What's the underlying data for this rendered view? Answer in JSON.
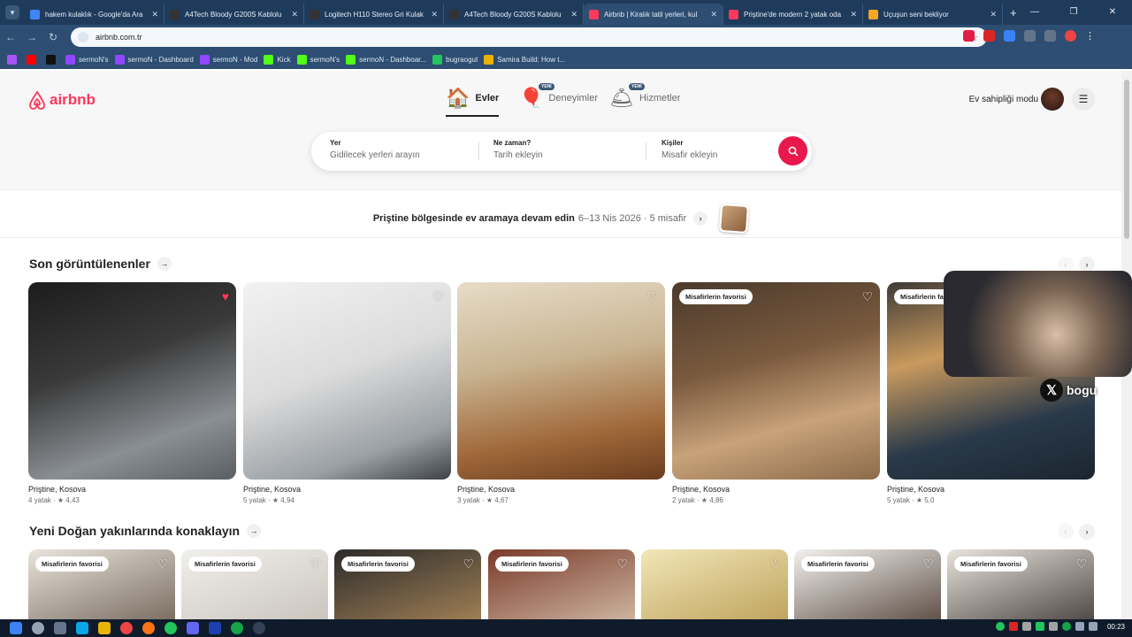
{
  "browser": {
    "tabs": [
      {
        "title": "hakem kulaklık - Google'da Ara",
        "color": "#4285f4",
        "active": false
      },
      {
        "title": "A4Tech Bloody G200S Kablolu",
        "color": "#333333",
        "active": false
      },
      {
        "title": "Logitech H110 Stereo Gri Kulak",
        "color": "#333333",
        "active": false
      },
      {
        "title": "A4Tech Bloody G200S Kablolu",
        "color": "#333333",
        "active": false
      },
      {
        "title": "Airbnb | Kiralık tatil yerleri, kul",
        "color": "#ff385c",
        "active": true
      },
      {
        "title": "Priştine'de modern 2 yatak oda",
        "color": "#ff385c",
        "active": false
      },
      {
        "title": "Uçuşun seni bekliyor",
        "color": "#f5a623",
        "active": false
      }
    ],
    "url": "airbnb.com.tr",
    "bookmarks": [
      {
        "label": "",
        "color": "#a855f7"
      },
      {
        "label": "",
        "color": "#ff0000"
      },
      {
        "label": "",
        "color": "#111111"
      },
      {
        "label": "sermoN's",
        "color": "#9146ff"
      },
      {
        "label": "sermoN - Dashboard",
        "color": "#9146ff"
      },
      {
        "label": "sermoN - Mod",
        "color": "#9146ff"
      },
      {
        "label": "Kick",
        "color": "#53fc18"
      },
      {
        "label": "sermoN's",
        "color": "#53fc18"
      },
      {
        "label": "sermoN - Dashboar...",
        "color": "#53fc18"
      },
      {
        "label": "bugraogut",
        "color": "#22c55e"
      },
      {
        "label": "Samira Build: How t...",
        "color": "#eab308"
      }
    ]
  },
  "header": {
    "logo": "airbnb",
    "categories": [
      {
        "label": "Evler",
        "icon": "house-icon",
        "glyph": "🏠",
        "new": ""
      },
      {
        "label": "Deneyimler",
        "icon": "balloon-icon",
        "glyph": "🎈",
        "new": "YENİ"
      },
      {
        "label": "Hizmetler",
        "icon": "bell-icon",
        "glyph": "🛎",
        "new": "YENİ"
      }
    ],
    "host_mode": "Ev sahipliği modu"
  },
  "search": {
    "where_label": "Yer",
    "where_placeholder": "Gidilecek yerleri arayın",
    "when_label": "Ne zaman?",
    "when_placeholder": "Tarih ekleyin",
    "who_label": "Kişiler",
    "who_placeholder": "Misafir ekleyin"
  },
  "continue_search": {
    "text": "Priştine bölgesinde ev aramaya devam edin",
    "details": "6–13 Nis 2026 · 5 misafir"
  },
  "recent": {
    "title": "Son görüntülenenler",
    "cards": [
      {
        "location": "Priştine, Kosova",
        "meta": "4 yatak · ★ 4,43",
        "badge": "",
        "liked": true,
        "img": "linear-gradient(160deg,#1c1c1c 0%,#3a3a3a 40%,#8a8f94 75%,#5a5f63 100%)"
      },
      {
        "location": "Priştine, Kosova",
        "meta": "5 yatak · ★ 4,94",
        "badge": "",
        "liked": false,
        "img": "linear-gradient(160deg,#f2f2f2 0%,#dcdcdc 45%,#9aa0a5 80%,#3d4145 100%)"
      },
      {
        "location": "Priştine, Kosova",
        "meta": "3 yatak · ★ 4,67",
        "badge": "",
        "liked": false,
        "img": "linear-gradient(170deg,#e7dcc8 0%,#c9b491 40%,#a0683a 75%,#6b3d1e 100%)"
      },
      {
        "location": "Priştine, Kosova",
        "meta": "2 yatak · ★ 4,86",
        "badge": "Misafirlerin favorisi",
        "liked": false,
        "img": "linear-gradient(165deg,#4b3a2c 0%,#7a5a3e 40%,#c8a27a 70%,#8c6b4a 100%)"
      },
      {
        "location": "Priştine, Kosova",
        "meta": "5 yatak · ★ 5,0",
        "badge": "Misafirlerin favorisi",
        "liked": false,
        "img": "linear-gradient(165deg,#3e3a36 0%,#c99a5e 35%,#2a3a4a 70%,#1a2530 100%)"
      }
    ]
  },
  "nearby": {
    "title": "Yeni Doğan yakınlarında konaklayın",
    "cards": [
      {
        "badge": "Misafirlerin favorisi",
        "img": "linear-gradient(160deg,#e9e4dc,#6a5d50)"
      },
      {
        "badge": "Misafirlerin favorisi",
        "img": "linear-gradient(160deg,#f1efec,#c5bfb7)"
      },
      {
        "badge": "Misafirlerin favorisi",
        "img": "linear-gradient(160deg,#2b2b2b,#b08a5a)"
      },
      {
        "badge": "Misafirlerin favorisi",
        "img": "linear-gradient(160deg,#7a3a2a,#d9c6b0)"
      },
      {
        "badge": "",
        "img": "linear-gradient(160deg,#f2e6b8,#b89a50)"
      },
      {
        "badge": "Misafirlerin favorisi",
        "img": "linear-gradient(160deg,#f3f1ee,#4a3a30)"
      },
      {
        "badge": "Misafirlerin favorisi",
        "img": "linear-gradient(160deg,#e8e3dc,#3a3330)"
      }
    ]
  },
  "overlay": {
    "handle": "bogu"
  },
  "taskbar": {
    "time": "00:23"
  }
}
